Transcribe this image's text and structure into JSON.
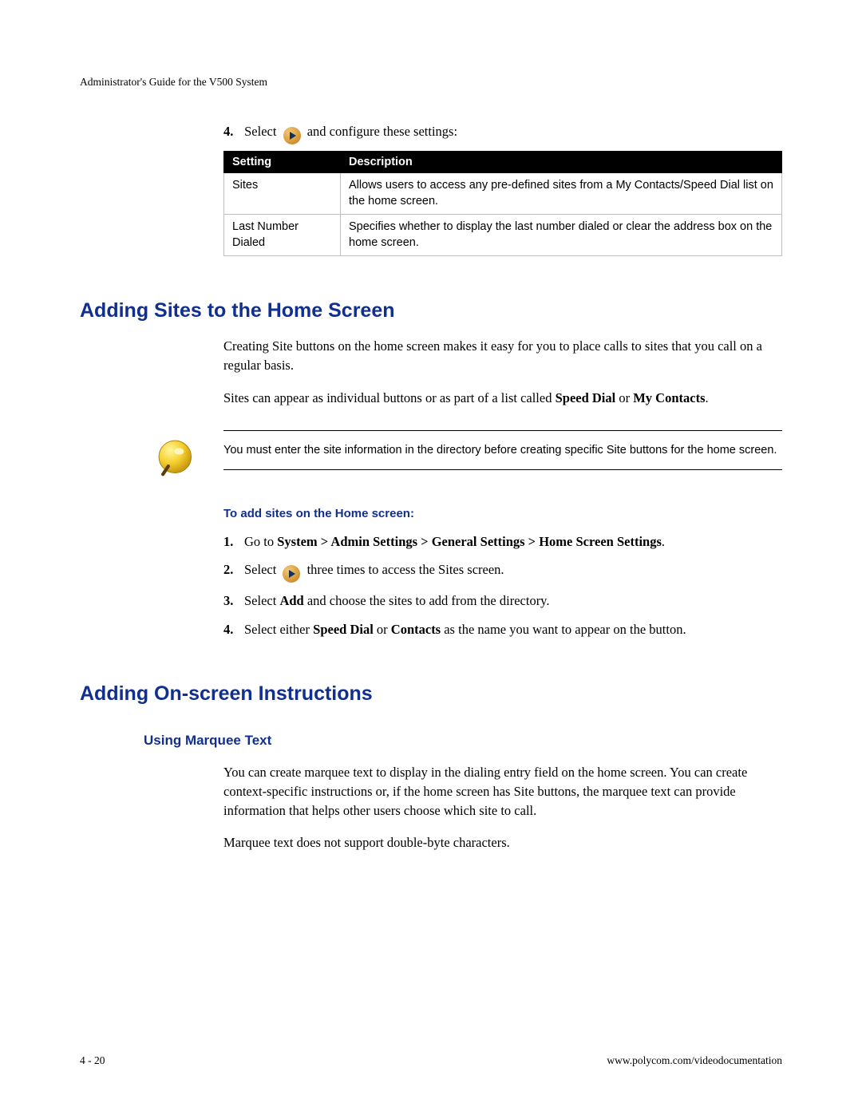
{
  "runningHead": "Administrator's Guide for the V500 System",
  "step4": {
    "num": "4.",
    "before": "Select",
    "after": "and configure these settings:"
  },
  "table": {
    "headers": {
      "col1": "Setting",
      "col2": "Description"
    },
    "rows": [
      {
        "setting": "Sites",
        "desc": "Allows users to access any pre-defined sites from a My Contacts/Speed Dial list on the home screen."
      },
      {
        "setting": "Last Number Dialed",
        "desc": "Specifies whether to display the last number dialed or clear the address box on the home screen."
      }
    ]
  },
  "sec1": {
    "title": "Adding Sites to the Home Screen",
    "p1": "Creating Site buttons on the home screen makes it easy for you to place calls to sites that you call on a regular basis.",
    "p2a": "Sites can appear as individual buttons or as part of a list called ",
    "p2b": "Speed Dial",
    "p2c": " or ",
    "p2d": "My Contacts",
    "p2e": ".",
    "note": "You must enter the site information in the directory before creating specific Site buttons for the home screen.",
    "procTitle": "To add sites on the Home screen:",
    "steps": {
      "s1a": "Go to ",
      "s1b": "System > Admin Settings > General Settings > Home Screen Settings",
      "s1c": ".",
      "s2a": "Select ",
      "s2b": " three times to access the Sites screen.",
      "s3a": "Select ",
      "s3b": "Add",
      "s3c": " and choose the sites to add from the directory.",
      "s4a": "Select either ",
      "s4b": "Speed Dial",
      "s4c": " or ",
      "s4d": "Contacts",
      "s4e": " as the name you want to appear on the button."
    }
  },
  "sec2": {
    "title": "Adding On-screen Instructions",
    "sub": "Using Marquee Text",
    "p1": "You can create marquee text to display in the dialing entry field on the home screen. You can create context-specific instructions or, if the home screen has Site buttons, the marquee text can provide information that helps other users choose which site to call.",
    "p2": "Marquee text does not support double-byte characters."
  },
  "footer": {
    "page": "4 - 20",
    "url": "www.polycom.com/videodocumentation"
  }
}
